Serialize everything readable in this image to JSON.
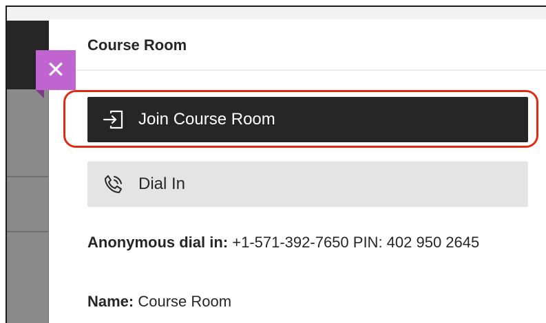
{
  "panel": {
    "title": "Course Room",
    "close_symbol": "✕"
  },
  "buttons": {
    "join_label": "Join Course Room",
    "join_icon": "enter-icon",
    "dial_label": "Dial In",
    "dial_icon": "phone-icon"
  },
  "info": {
    "anon_label": "Anonymous dial in:",
    "anon_value": " +1-571-392-7650 PIN: 402 950 2645",
    "name_label": "Name:",
    "name_value": " Course Room"
  },
  "colors": {
    "highlight": "#e12a12",
    "close_button": "#c065cf",
    "join_button": "#262626",
    "dial_button": "#e4e4e4"
  }
}
